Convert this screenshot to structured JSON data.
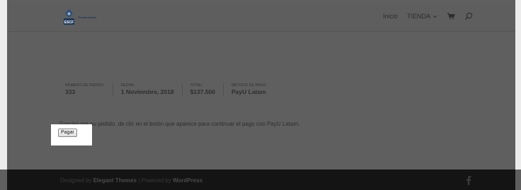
{
  "header": {
    "logo": {
      "text_main": "Tienda virtual",
      "text_sub": "",
      "mark_text": "ESCF"
    },
    "nav": {
      "home_label": "Inicio",
      "shop_label": "TIENDA"
    },
    "icons": {
      "cart": "cart-icon",
      "search": "search-icon",
      "chevron": "chevron-down-icon"
    }
  },
  "order": {
    "number": {
      "label": "NÚMERO DE PEDIDO:",
      "value": "333"
    },
    "date": {
      "label": "FECHA:",
      "value": "1 Noviembre, 2018"
    },
    "total": {
      "label": "TOTAL:",
      "value": "$137.500"
    },
    "method": {
      "label": "MÉTODO DE PAGO:",
      "value": "PayU Latam"
    }
  },
  "payment": {
    "message": "Gracias por su pedido, de clic en el botón que aparece para continuar el pago con PayU Latam.",
    "button_label": "Pagar"
  },
  "footer": {
    "prefix": "Designed by ",
    "theme_link": "Elegant Themes",
    "separator": " | Powered by ",
    "wp_link": "WordPress",
    "social_icon": "facebook-icon"
  },
  "colors": {
    "overlay": "#5f5f5f",
    "footer": "#141414",
    "highlight": "#ffffff"
  }
}
